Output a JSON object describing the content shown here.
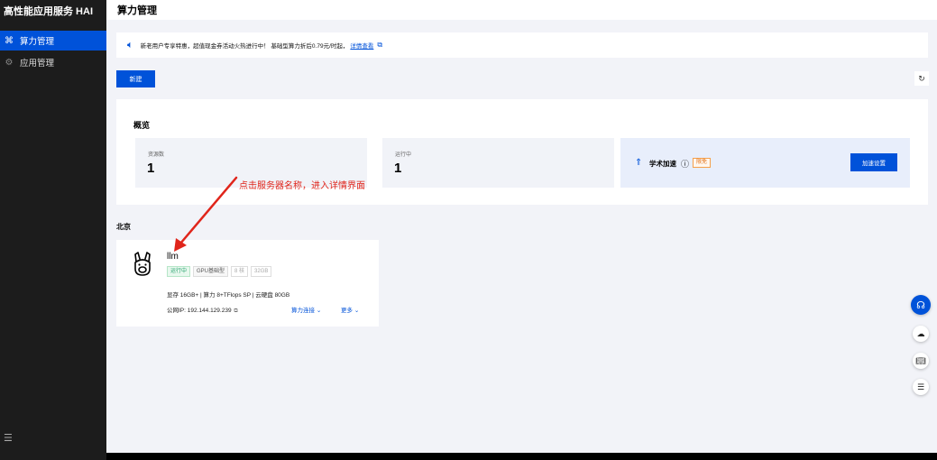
{
  "sidebar": {
    "title": "高性能应用服务 HAI",
    "items": [
      {
        "label": "算力管理",
        "icon": "hai-grid-icon"
      },
      {
        "label": "应用管理",
        "icon": "app-gear-icon"
      }
    ],
    "footer_icon": "collapse-menu-icon"
  },
  "header": {
    "title": "算力管理"
  },
  "notice": {
    "text": "新老用户专享特惠，超值现金券活动火热进行中！ 基础型算力折后0.79元/时起，",
    "link": "详情查看"
  },
  "toolbar": {
    "new_label": "新建"
  },
  "overview": {
    "title": "概览",
    "stats": [
      {
        "label": "资源数",
        "value": "1"
      },
      {
        "label": "运行中",
        "value": "1"
      }
    ],
    "accel": {
      "label": "学术加速",
      "badge": "限免",
      "button": "加速设置"
    }
  },
  "annotation": "点击服务器名称，进入详情界面",
  "region": "北京",
  "instance": {
    "name": "llm",
    "status": "运行中",
    "type": "GPU基础型",
    "cores": "8 核",
    "memory": "32GB",
    "spec": "显存 16GB+ | 算力 8+TFlops SP | 云硬盘 80GB",
    "ip_label": "公网IP:",
    "ip": "192.144.129.239",
    "action_connect": "算力连接",
    "action_more": "更多"
  },
  "colors": {
    "accent": "#0052d9",
    "running": "#2ba471",
    "annotation": "#e0251b",
    "badge": "#e37318"
  }
}
